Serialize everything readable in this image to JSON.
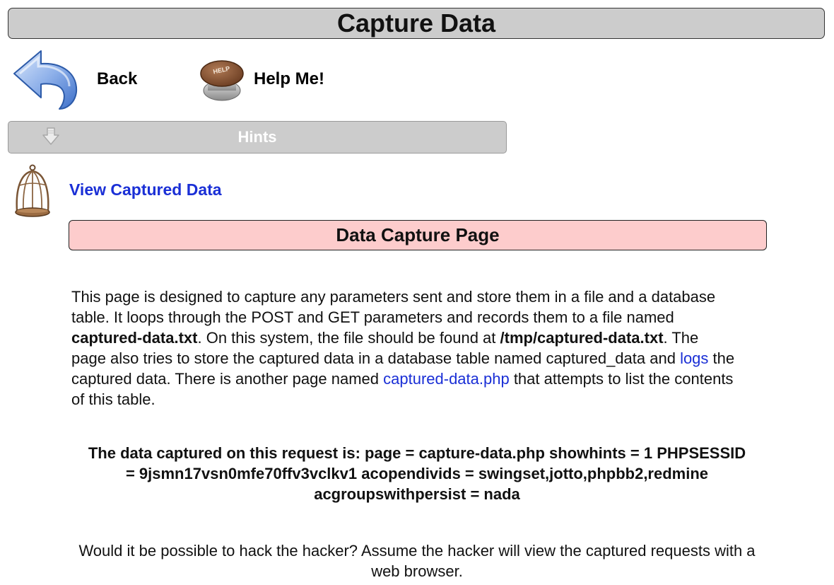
{
  "header": {
    "title": "Capture Data"
  },
  "nav": {
    "back_label": "Back",
    "help_label": "Help Me!",
    "help_button_text": "HELP"
  },
  "hints": {
    "label": "Hints"
  },
  "captured_link": {
    "label": "View Captured Data"
  },
  "panel": {
    "title": "Data Capture Page"
  },
  "description": {
    "t1": "This page is designed to capture any parameters sent and store them in a file and a database table. It loops through the POST and GET parameters and records them to a file named ",
    "file_name": "captured-data.txt",
    "t2": ". On this system, the file should be found at ",
    "file_path": "/tmp/captured-data.txt",
    "t3": ". The page also tries to store the captured data in a database table named captured_data and ",
    "logs_link": "logs",
    "t4": " the captured data. There is another page named ",
    "page_link": "captured-data.php",
    "t5": " that attempts to list the contents of this table."
  },
  "captured_text": "The data captured on this request is: page = capture-data.php showhints = 1 PHPSESSID = 9jsmn17vsn0mfe70ffv3vclkv1 acopendivids = swingset,jotto,phpbb2,redmine acgroupswithpersist = nada",
  "question": "Would it be possible to hack the hacker? Assume the hacker will view the captured requests with a web browser.",
  "colors": {
    "title_bg": "#cccccc",
    "panel_bg": "#fdcccc",
    "link": "#1a2fd6",
    "hints_text": "#ffffff"
  }
}
